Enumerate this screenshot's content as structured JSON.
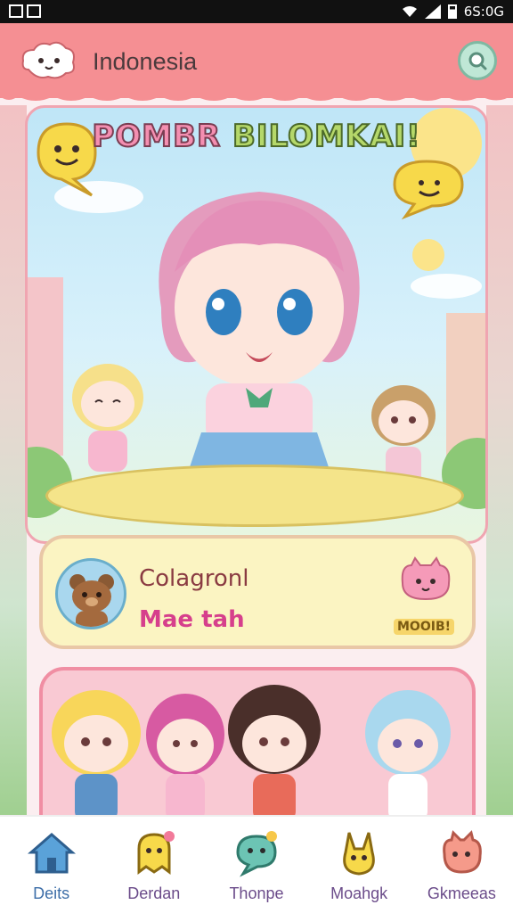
{
  "status_bar": {
    "time": "6S:0G"
  },
  "header": {
    "title": "Indonesia",
    "logo_icon": "cloud-mascot-icon",
    "search_icon": "search-icon"
  },
  "hero": {
    "title_word1": "POMBR",
    "title_word2": "BILOMKAI!"
  },
  "info_card": {
    "line1": "Colagronl",
    "line2": "Mae tah",
    "badge_label": "MOOIB!",
    "avatar_icon": "bear-icon",
    "badge_icon": "pink-cat-icon"
  },
  "bottom_nav": {
    "items": [
      {
        "label": "Deits",
        "icon": "home-icon",
        "active": true
      },
      {
        "label": "Derdan",
        "icon": "yellow-creature-icon",
        "active": false
      },
      {
        "label": "Thonpe",
        "icon": "chat-bubble-icon",
        "active": false
      },
      {
        "label": "Moahgk",
        "icon": "bunny-icon",
        "active": false
      },
      {
        "label": "Gkmeeas",
        "icon": "pink-pig-icon",
        "active": false
      }
    ]
  },
  "colors": {
    "header": "#f58f93",
    "accent_pink": "#f08ea3",
    "card_yellow": "#fbf4c2",
    "nav_active": "#3d6ea8"
  }
}
